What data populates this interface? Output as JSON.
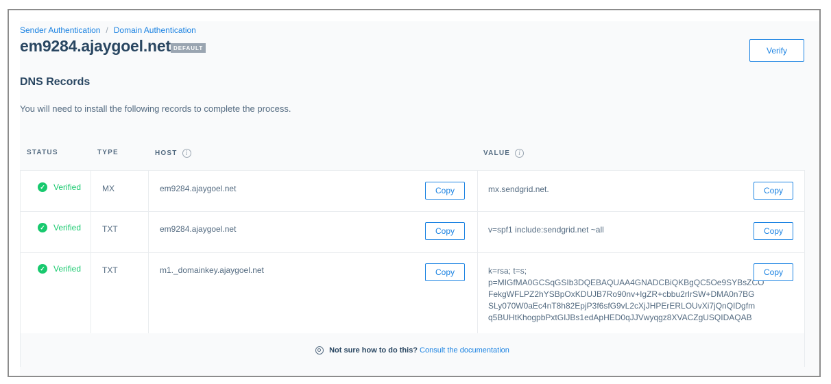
{
  "breadcrumb": {
    "items": [
      "Sender Authentication",
      "Domain Authentication"
    ],
    "separator": "/"
  },
  "header": {
    "title": "em9284.ajaygoel.net",
    "badge": "DEFAULT",
    "verify_label": "Verify"
  },
  "section": {
    "title": "DNS Records",
    "description": "You will need to install the following records to complete the process."
  },
  "table": {
    "columns": [
      "STATUS",
      "TYPE",
      "HOST",
      "VALUE"
    ],
    "rows": [
      {
        "status": "Verified",
        "type": "MX",
        "host": "em9284.ajaygoel.net",
        "value_lines": [
          "mx.sendgrid.net."
        ],
        "copy_label": "Copy"
      },
      {
        "status": "Verified",
        "type": "TXT",
        "host": "em9284.ajaygoel.net",
        "value_lines": [
          "v=spf1 include:sendgrid.net ~all"
        ],
        "copy_label": "Copy"
      },
      {
        "status": "Verified",
        "type": "TXT",
        "host": "m1._domainkey.ajaygoel.net",
        "value_lines": [
          "k=rsa; t=s;",
          "p=MIGfMA0GCSqGSIb3DQEBAQUAA4GNADCBiQKBgQC5Oe9SYBsZCO",
          "FekgWFLPZ2hYSBpOxKDUJB7Ro90nv+IgZR+cbbu2rIrSW+DMA0n7BG",
          "SLy070W0aEc4nT8h82EpjP3f6sfG9vL2cXjJHPErERLOUvXi7jQnQIDgfm",
          "q5BUHtKhogpbPxtGIJBs1edApHED0qJJVwyqgz8XVACZgUSQIDAQAB"
        ],
        "copy_label": "Copy"
      }
    ]
  },
  "footer": {
    "question": "Not sure how to do this?",
    "link": "Consult the documentation"
  },
  "colors": {
    "accent": "#1a82e2",
    "success": "#18c96e",
    "text_dark": "#294661",
    "text_muted": "#546b81"
  },
  "icons": {
    "status": "check-circle-icon",
    "info": "info-icon",
    "help": "lifebuoy-icon"
  }
}
